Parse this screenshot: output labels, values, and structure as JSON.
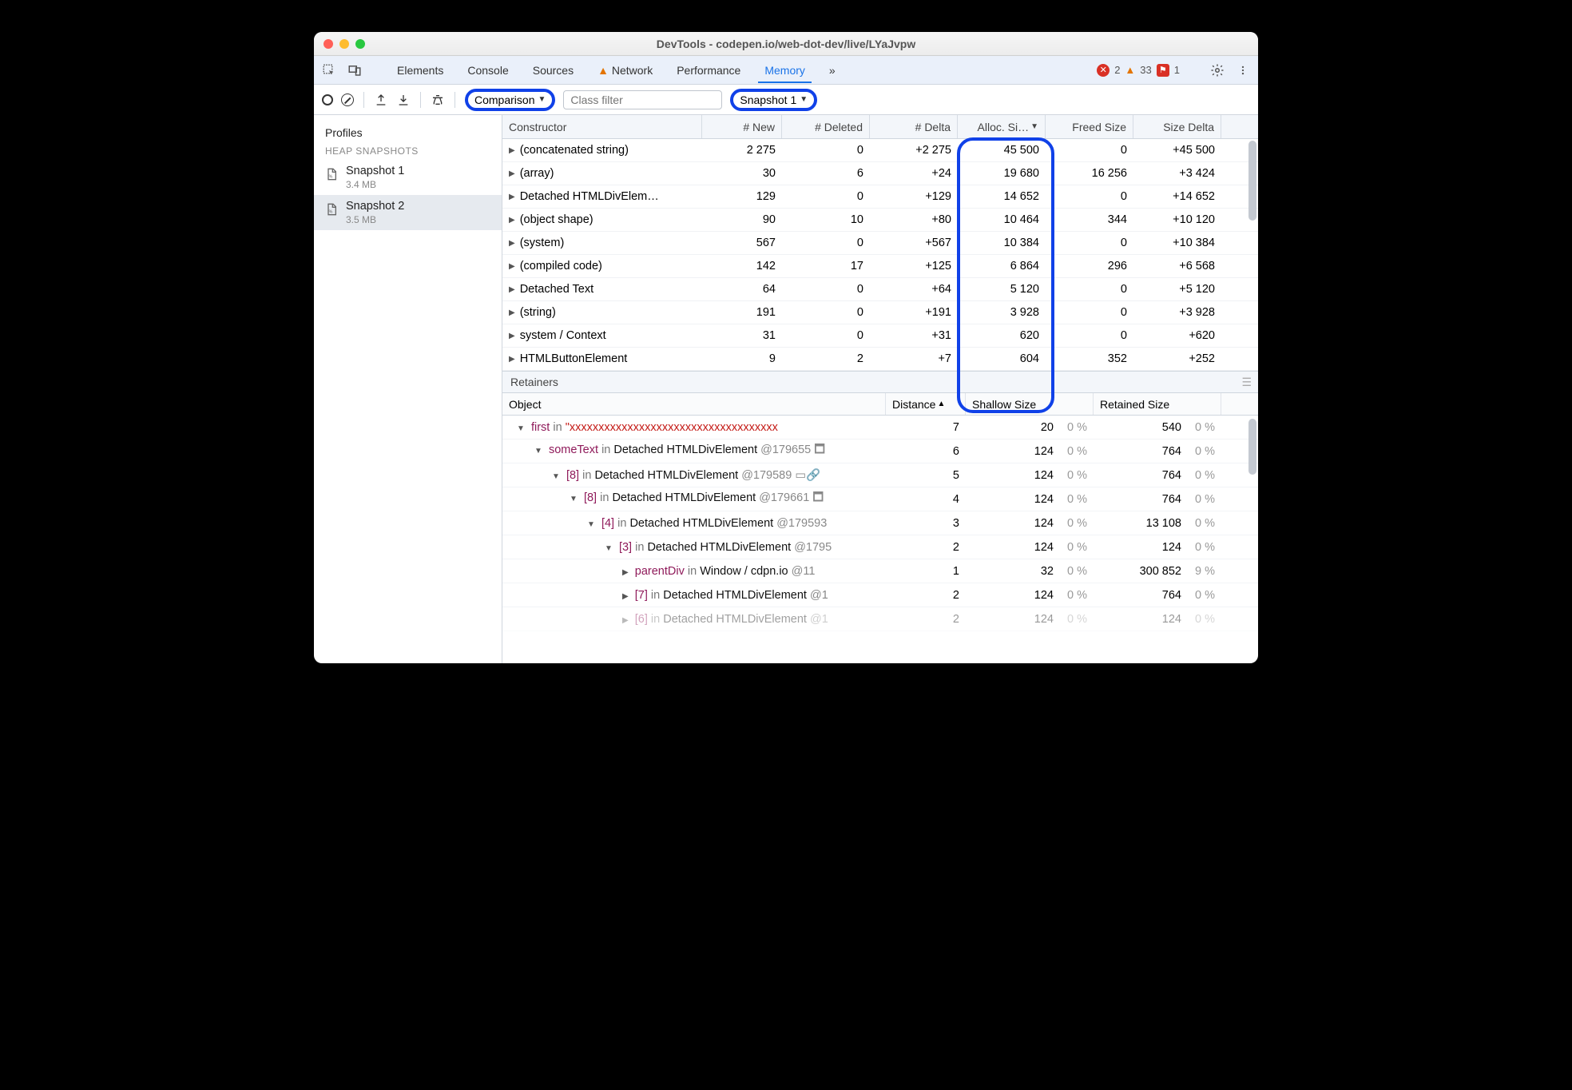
{
  "window_title": "DevTools - codepen.io/web-dot-dev/live/LYaJvpw",
  "tabs": {
    "elements": "Elements",
    "console": "Console",
    "sources": "Sources",
    "network": "Network",
    "performance": "Performance",
    "memory": "Memory",
    "more": "»"
  },
  "status": {
    "errors": "2",
    "warnings": "33",
    "messages": "1"
  },
  "sidebar": {
    "profiles_label": "Profiles",
    "section_label": "HEAP SNAPSHOTS",
    "items": [
      {
        "name": "Snapshot 1",
        "size": "3.4 MB"
      },
      {
        "name": "Snapshot 2",
        "size": "3.5 MB"
      }
    ]
  },
  "toolbar": {
    "view_select": "Comparison",
    "class_filter_placeholder": "Class filter",
    "baseline_select": "Snapshot 1"
  },
  "grid": {
    "columns": [
      "Constructor",
      "# New",
      "# Deleted",
      "# Delta",
      "Alloc. Si…",
      "Freed Size",
      "Size Delta"
    ],
    "alloc_sort_desc": true,
    "rows": [
      {
        "constructor": "(concatenated string)",
        "new": "2 275",
        "deleted": "0",
        "delta": "+2 275",
        "alloc": "45 500",
        "freed": "0",
        "sdelta": "+45 500"
      },
      {
        "constructor": "(array)",
        "new": "30",
        "deleted": "6",
        "delta": "+24",
        "alloc": "19 680",
        "freed": "16 256",
        "sdelta": "+3 424"
      },
      {
        "constructor": "Detached HTMLDivElem…",
        "new": "129",
        "deleted": "0",
        "delta": "+129",
        "alloc": "14 652",
        "freed": "0",
        "sdelta": "+14 652"
      },
      {
        "constructor": "(object shape)",
        "new": "90",
        "deleted": "10",
        "delta": "+80",
        "alloc": "10 464",
        "freed": "344",
        "sdelta": "+10 120"
      },
      {
        "constructor": "(system)",
        "new": "567",
        "deleted": "0",
        "delta": "+567",
        "alloc": "10 384",
        "freed": "0",
        "sdelta": "+10 384"
      },
      {
        "constructor": "(compiled code)",
        "new": "142",
        "deleted": "17",
        "delta": "+125",
        "alloc": "6 864",
        "freed": "296",
        "sdelta": "+6 568"
      },
      {
        "constructor": "Detached Text",
        "new": "64",
        "deleted": "0",
        "delta": "+64",
        "alloc": "5 120",
        "freed": "0",
        "sdelta": "+5 120"
      },
      {
        "constructor": "(string)",
        "new": "191",
        "deleted": "0",
        "delta": "+191",
        "alloc": "3 928",
        "freed": "0",
        "sdelta": "+3 928"
      },
      {
        "constructor": "system / Context",
        "new": "31",
        "deleted": "0",
        "delta": "+31",
        "alloc": "620",
        "freed": "0",
        "sdelta": "+620"
      },
      {
        "constructor": "HTMLButtonElement",
        "new": "9",
        "deleted": "2",
        "delta": "+7",
        "alloc": "604",
        "freed": "352",
        "sdelta": "+252"
      }
    ]
  },
  "retainers": {
    "title": "Retainers",
    "columns": [
      "Object",
      "Distance",
      "Shallow Size",
      "Retained Size"
    ],
    "rows": [
      {
        "indent": 0,
        "open": true,
        "key": "first",
        "in_label": "in",
        "str": "\"xxxxxxxxxxxxxxxxxxxxxxxxxxxxxxxxxxxx",
        "type": "",
        "addr": "",
        "dist": "7",
        "shallow": "20",
        "shallow_pct": "0 %",
        "ret": "540",
        "ret_pct": "0 %"
      },
      {
        "indent": 1,
        "open": true,
        "key": "someText",
        "in_label": "in",
        "str": "",
        "type": "Detached HTMLDivElement",
        "addr": "@179655 🗖",
        "dist": "6",
        "shallow": "124",
        "shallow_pct": "0 %",
        "ret": "764",
        "ret_pct": "0 %"
      },
      {
        "indent": 2,
        "open": true,
        "key": "[8]",
        "in_label": "in",
        "str": "",
        "type": "Detached HTMLDivElement",
        "addr": "@179589 ▭🔗",
        "dist": "5",
        "shallow": "124",
        "shallow_pct": "0 %",
        "ret": "764",
        "ret_pct": "0 %"
      },
      {
        "indent": 3,
        "open": true,
        "key": "[8]",
        "in_label": "in",
        "str": "",
        "type": "Detached HTMLDivElement",
        "addr": "@179661 🗖",
        "dist": "4",
        "shallow": "124",
        "shallow_pct": "0 %",
        "ret": "764",
        "ret_pct": "0 %"
      },
      {
        "indent": 4,
        "open": true,
        "key": "[4]",
        "in_label": "in",
        "str": "",
        "type": "Detached HTMLDivElement",
        "addr": "@179593",
        "dist": "3",
        "shallow": "124",
        "shallow_pct": "0 %",
        "ret": "13 108",
        "ret_pct": "0 %"
      },
      {
        "indent": 5,
        "open": true,
        "key": "[3]",
        "in_label": "in",
        "str": "",
        "type": "Detached HTMLDivElement",
        "addr": "@1795",
        "dist": "2",
        "shallow": "124",
        "shallow_pct": "0 %",
        "ret": "124",
        "ret_pct": "0 %"
      },
      {
        "indent": 6,
        "open": false,
        "key": "parentDiv",
        "in_label": "in",
        "str": "",
        "type": "Window / cdpn.io",
        "addr": "@11",
        "dist": "1",
        "shallow": "32",
        "shallow_pct": "0 %",
        "ret": "300 852",
        "ret_pct": "9 %"
      },
      {
        "indent": 6,
        "open": false,
        "key": "[7]",
        "in_label": "in",
        "str": "",
        "type": "Detached HTMLDivElement",
        "addr": "@1",
        "dist": "2",
        "shallow": "124",
        "shallow_pct": "0 %",
        "ret": "764",
        "ret_pct": "0 %"
      },
      {
        "indent": 6,
        "open": false,
        "key": "[6]",
        "in_label": "in",
        "str": "",
        "type": "Detached HTMLDivElement",
        "addr": "@1",
        "dist": "2",
        "shallow": "124",
        "shallow_pct": "0 %",
        "ret": "124",
        "ret_pct": "0 %",
        "dim": true
      }
    ]
  }
}
